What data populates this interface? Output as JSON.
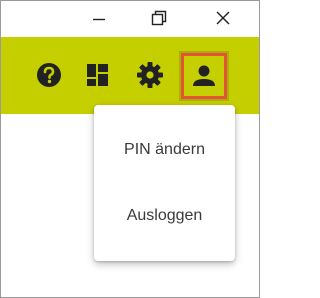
{
  "window_controls": {
    "minimize": "minimize-icon",
    "maximize": "restore-icon",
    "close": "close-icon"
  },
  "toolbar": {
    "accent_color": "#c5cf00",
    "icons": [
      "help-icon",
      "dashboard-icon",
      "settings-icon",
      "account-icon"
    ],
    "active_icon": "account-icon",
    "highlight_color": "#e5533d"
  },
  "account_menu": {
    "items": [
      {
        "label": "PIN ändern"
      },
      {
        "label": "Ausloggen"
      }
    ]
  }
}
